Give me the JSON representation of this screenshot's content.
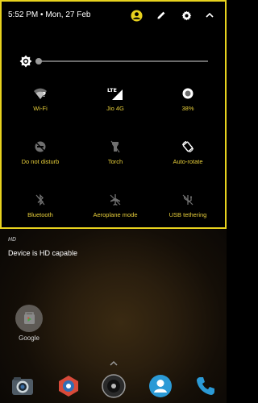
{
  "status": {
    "time": "5:52 PM",
    "date": "Mon, 27 Feb",
    "icons": [
      "account-icon",
      "edit-icon",
      "settings-icon",
      "collapse-icon"
    ]
  },
  "brightness": {
    "level": 0.02
  },
  "tiles": [
    {
      "label": "Wi-Fi",
      "icon": "wifi-icon"
    },
    {
      "label": "Jio 4G",
      "icon": "signal-icon",
      "badge": "LTE"
    },
    {
      "label": "38%",
      "icon": "battery-icon"
    },
    {
      "label": "Do not disturb",
      "icon": "dnd-icon"
    },
    {
      "label": "Torch",
      "icon": "torch-icon"
    },
    {
      "label": "Auto-rotate",
      "icon": "auto-rotate-icon"
    },
    {
      "label": "Bluetooth",
      "icon": "bluetooth-icon"
    },
    {
      "label": "Aeroplane mode",
      "icon": "airplane-icon"
    },
    {
      "label": "USB tethering",
      "icon": "usb-tethering-icon"
    }
  ],
  "notification": {
    "app": "HD",
    "text": "Device is HD capable"
  },
  "home": {
    "app_label": "Google"
  },
  "colors": {
    "accent": "#e8d21e",
    "label": "#e8cf3a"
  }
}
